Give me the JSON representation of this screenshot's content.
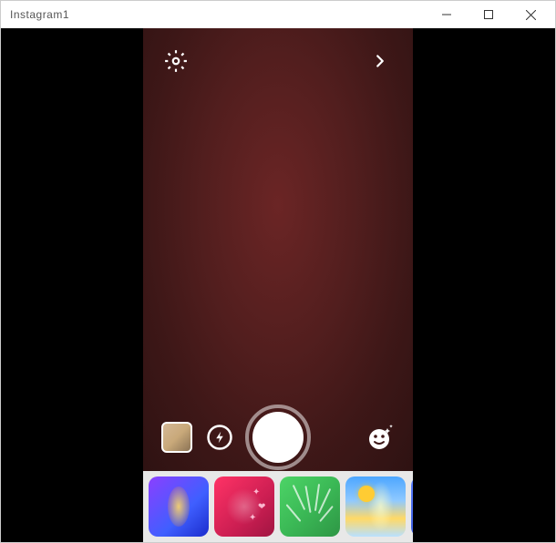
{
  "window": {
    "title": "Instagram1"
  },
  "icons": {
    "settings": "gear",
    "forward": "chevron-right",
    "flash": "flash",
    "face_effects": "smiley-sparkle"
  },
  "filters": [
    {
      "name": "purple-glow",
      "style": "f0"
    },
    {
      "name": "pink-hearts",
      "style": "f1"
    },
    {
      "name": "tropical-leaves",
      "style": "f2"
    },
    {
      "name": "sunny-beam",
      "style": "f3"
    },
    {
      "name": "blue-swirl",
      "style": "f4"
    }
  ]
}
